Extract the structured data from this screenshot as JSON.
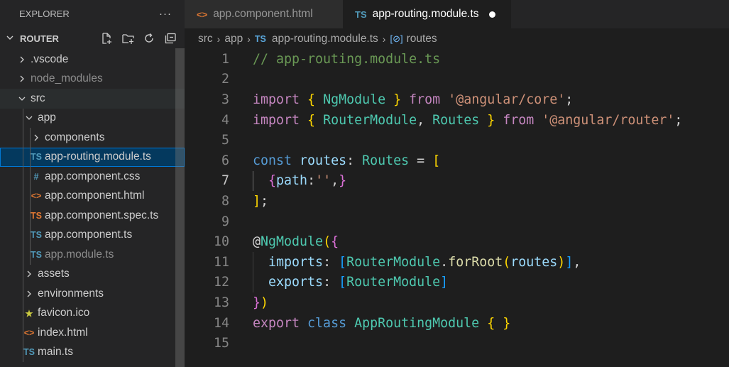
{
  "explorer": {
    "title": "EXPLORER",
    "more": "···",
    "section_title": "ROUTER",
    "items": [
      {
        "label": ".vscode",
        "depth": 1,
        "type": "folder",
        "state": "collapsed"
      },
      {
        "label": "node_modules",
        "depth": 1,
        "type": "folder",
        "state": "collapsed",
        "dim": true
      },
      {
        "label": "src",
        "depth": 1,
        "type": "folder",
        "state": "expanded",
        "hover": true
      },
      {
        "label": "app",
        "depth": 2,
        "type": "folder",
        "state": "expanded"
      },
      {
        "label": "components",
        "depth": 3,
        "type": "folder",
        "state": "collapsed"
      },
      {
        "label": "app-routing.module.ts",
        "depth": 3,
        "type": "ts",
        "icon": "TS",
        "icon_color": "#519aba",
        "selected": true
      },
      {
        "label": "app.component.css",
        "depth": 3,
        "type": "css",
        "icon": "#",
        "icon_color": "#519aba"
      },
      {
        "label": "app.component.html",
        "depth": 3,
        "type": "html",
        "icon": "<>",
        "icon_color": "#e37933"
      },
      {
        "label": "app.component.spec.ts",
        "depth": 3,
        "type": "spec",
        "icon": "TS",
        "icon_color": "#e37933"
      },
      {
        "label": "app.component.ts",
        "depth": 3,
        "type": "ts",
        "icon": "TS",
        "icon_color": "#519aba"
      },
      {
        "label": "app.module.ts",
        "depth": 3,
        "type": "ts",
        "icon": "TS",
        "icon_color": "#519aba",
        "dim": true
      },
      {
        "label": "assets",
        "depth": 2,
        "type": "folder",
        "state": "collapsed"
      },
      {
        "label": "environments",
        "depth": 2,
        "type": "folder",
        "state": "collapsed"
      },
      {
        "label": "favicon.ico",
        "depth": 2,
        "type": "ico",
        "icon": "★",
        "icon_color": "#cbcb41"
      },
      {
        "label": "index.html",
        "depth": 2,
        "type": "html",
        "icon": "<>",
        "icon_color": "#e37933"
      },
      {
        "label": "main.ts",
        "depth": 2,
        "type": "ts",
        "icon": "TS",
        "icon_color": "#519aba"
      }
    ]
  },
  "tabs": [
    {
      "label": "app.component.html",
      "icon": "<>",
      "icon_color": "#e37933",
      "active": false
    },
    {
      "label": "app-routing.module.ts",
      "icon": "TS",
      "icon_color": "#519aba",
      "active": true,
      "dirty": true
    }
  ],
  "breadcrumb": {
    "parts": [
      "src",
      "app",
      "app-routing.module.ts",
      "routes"
    ],
    "file_icon": "TS",
    "symbol_icon": "[⊘]"
  },
  "editor": {
    "current_line": 7,
    "lines": [
      [
        [
          "// app-routing.module.ts",
          "cm"
        ]
      ],
      [],
      [
        [
          "import ",
          "kw"
        ],
        [
          "{",
          "p1"
        ],
        [
          " NgModule ",
          "cls"
        ],
        [
          "}",
          "p1"
        ],
        [
          " from ",
          "kw"
        ],
        [
          "'@angular/core'",
          "str"
        ],
        [
          ";",
          "op"
        ]
      ],
      [
        [
          "import ",
          "kw"
        ],
        [
          "{",
          "p1"
        ],
        [
          " RouterModule",
          "cls"
        ],
        [
          ", ",
          "op"
        ],
        [
          "Routes ",
          "cls"
        ],
        [
          "}",
          "p1"
        ],
        [
          " from ",
          "kw"
        ],
        [
          "'@angular/router'",
          "str"
        ],
        [
          ";",
          "op"
        ]
      ],
      [],
      [
        [
          "const ",
          "kb"
        ],
        [
          "routes",
          "var"
        ],
        [
          ": ",
          "op"
        ],
        [
          "Routes",
          "cls"
        ],
        [
          " = ",
          "op"
        ],
        [
          "[",
          "p1"
        ]
      ],
      [
        [
          "  ",
          "op"
        ],
        [
          "{",
          "p2"
        ],
        [
          "path",
          "var"
        ],
        [
          ":",
          "op"
        ],
        [
          "''",
          "str"
        ],
        [
          ",",
          "op"
        ],
        [
          "}",
          "p2"
        ]
      ],
      [
        [
          "]",
          "p1"
        ],
        [
          ";",
          "op"
        ]
      ],
      [],
      [
        [
          "@",
          "op"
        ],
        [
          "NgModule",
          "cls"
        ],
        [
          "(",
          "p1"
        ],
        [
          "{",
          "p2"
        ]
      ],
      [
        [
          "  imports",
          "var"
        ],
        [
          ": ",
          "op"
        ],
        [
          "[",
          "p3"
        ],
        [
          "RouterModule",
          "cls"
        ],
        [
          ".",
          "op"
        ],
        [
          "forRoot",
          "fn"
        ],
        [
          "(",
          "p1"
        ],
        [
          "routes",
          "var"
        ],
        [
          ")",
          "p1"
        ],
        [
          "]",
          "p3"
        ],
        [
          ",",
          "op"
        ]
      ],
      [
        [
          "  exports",
          "var"
        ],
        [
          ": ",
          "op"
        ],
        [
          "[",
          "p3"
        ],
        [
          "RouterModule",
          "cls"
        ],
        [
          "]",
          "p3"
        ]
      ],
      [
        [
          "}",
          "p2"
        ],
        [
          ")",
          "p1"
        ]
      ],
      [
        [
          "export ",
          "kw"
        ],
        [
          "class ",
          "kb"
        ],
        [
          "AppRoutingModule ",
          "cls"
        ],
        [
          "{",
          "p1"
        ],
        [
          " ",
          "op"
        ],
        [
          "}",
          "p1"
        ]
      ],
      []
    ]
  },
  "colors": {
    "accent": "#0078d4",
    "selection": "#04395e",
    "sidebar_bg": "#252526",
    "editor_bg": "#1e1e1e"
  }
}
